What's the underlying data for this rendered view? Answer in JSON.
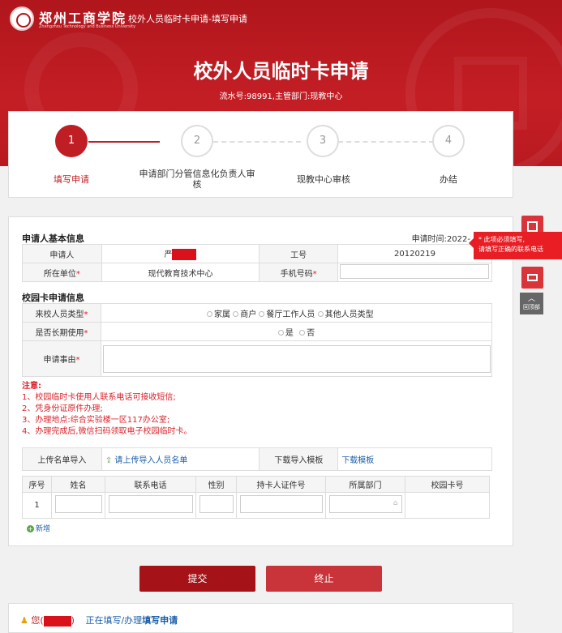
{
  "header": {
    "school_name": "郑州工商学院",
    "school_name_en": "Zhengzhou Technology and Business University",
    "breadcrumb": "校外人员临时卡申请-填写申请",
    "title": "校外人员临时卡申请",
    "subtitle": "流水号:98991,主管部门:现教中心"
  },
  "steps": [
    {
      "num": "1",
      "label": "填写申请",
      "active": true
    },
    {
      "num": "2",
      "label": "申请部门分管信息化负责人审核"
    },
    {
      "num": "3",
      "label": "现教中心审核"
    },
    {
      "num": "4",
      "label": "办结"
    }
  ],
  "applicant_section": {
    "title": "申请人基本信息",
    "apply_time_label": "申请时间:",
    "apply_time_value": "2022-",
    "applicant_label": "申请人",
    "applicant_value": "严",
    "job_no_label": "工号",
    "job_no_value": "20120219",
    "unit_label": "所在单位",
    "unit_value": "现代教育技术中心",
    "phone_label": "手机号码"
  },
  "card_section": {
    "title": "校园卡申请信息",
    "visitor_type_label": "来校人员类型",
    "visitor_types": [
      "家属",
      "商户",
      "餐厅工作人员",
      "其他人员类型"
    ],
    "long_term_label": "是否长期使用",
    "long_term_options": [
      "是",
      "否"
    ],
    "reason_label": "申请事由"
  },
  "notes": {
    "title": "注意:",
    "items": [
      "1、校园临时卡使用人联系电话可接收短信;",
      "2、凭身份证原件办理;",
      "3、办理地点:综合实验楼一区117办公室;",
      "4、办理完成后,微信扫码领取电子校园临时卡。"
    ]
  },
  "upload": {
    "label": "上传名单导入",
    "link": "请上传导入人员名单",
    "download_label": "下载导入模板",
    "download_link": "下载模板"
  },
  "people_table": {
    "headers": [
      "序号",
      "姓名",
      "联系电话",
      "性别",
      "持卡人证件号",
      "所属部门",
      "校园卡号"
    ],
    "rows": [
      {
        "index": "1"
      }
    ]
  },
  "add_label": "新增",
  "actions": {
    "submit": "提交",
    "stop": "终止"
  },
  "status_bar": {
    "prefix": "您(",
    "text": "正在填写/办理",
    "task": "填写申请"
  },
  "tooltip": {
    "line1": "* 此项必须填写,",
    "line2": "请填写正确的联系电话"
  },
  "side": {
    "back_top": "回顶部"
  },
  "colors": {
    "brand_red": "#c01e25",
    "required": "#d9222a",
    "link_blue": "#1a5ea8"
  }
}
